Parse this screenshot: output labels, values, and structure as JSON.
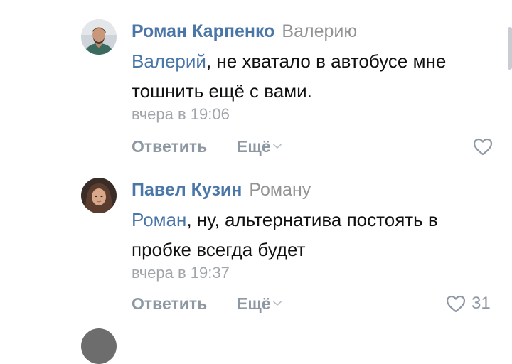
{
  "comments": [
    {
      "author": "Роман Карпенко",
      "reply_to": "Валерию",
      "mention": "Валерий",
      "text": ", не хватало в автобусе мне тошнить ещё с вами.",
      "time": "вчера в 19:06",
      "reply_label": "Ответить",
      "more_label": "Ещё",
      "likes": "",
      "avatar_icon": "user-photo-avatar",
      "liked": false
    },
    {
      "author": "Павел Кузин",
      "reply_to": "Роману",
      "mention": "Роман",
      "text": ", ну, альтернатива постоять в пробке всегда будет",
      "time": "вчера в 19:37",
      "reply_label": "Ответить",
      "more_label": "Ещё",
      "likes": "31",
      "avatar_icon": "user-photo-avatar",
      "liked": false
    }
  ],
  "colors": {
    "link": "#4a76a8",
    "secondary": "#939393",
    "action": "#8e98a3",
    "text": "#111111"
  }
}
